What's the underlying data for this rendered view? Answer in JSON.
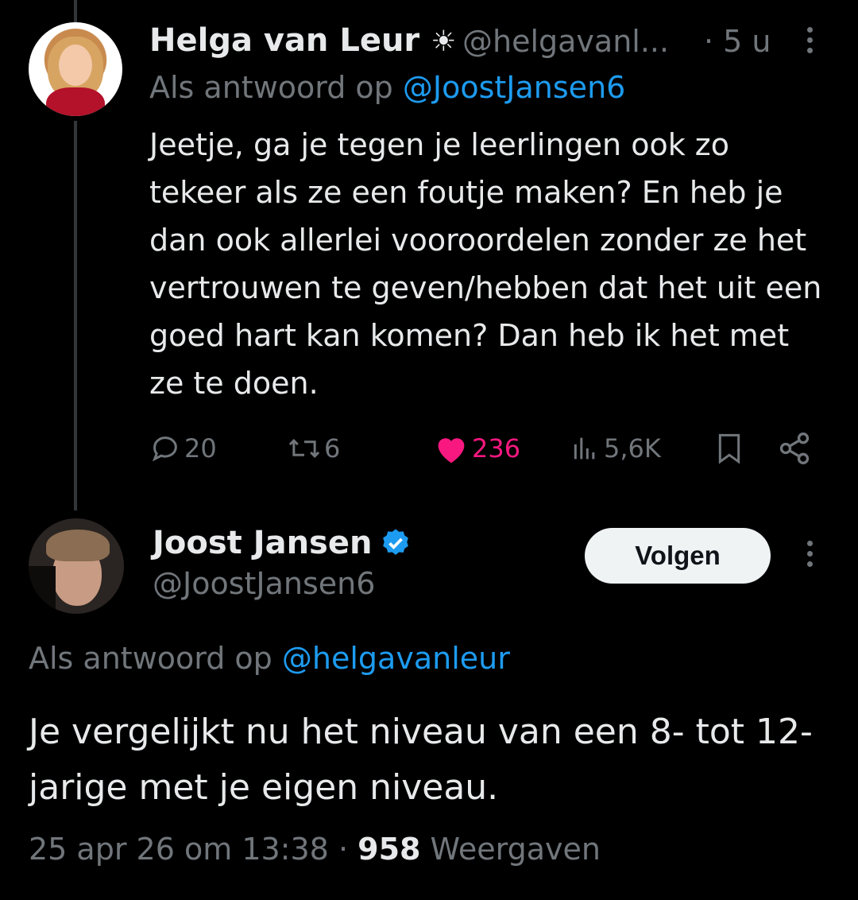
{
  "colors": {
    "background": "#000000",
    "text": "#e7e9ea",
    "muted": "#71767b",
    "link": "#1d9bf0",
    "like": "#f91880"
  },
  "tweet1": {
    "author": "Helga van Leur",
    "emoji": "☀️",
    "handle": "@helgavanl...",
    "time": "· 5 u",
    "reply_prefix": "Als antwoord op",
    "reply_to": "@JoostJansen6",
    "text": "Jeetje, ga je tegen je leerlingen ook zo tekeer als ze een foutje maken? En heb je dan ook allerlei vooroordelen zonder ze het vertrouwen te geven/hebben dat het uit een goed hart kan komen? Dan heb ik het met ze te doen.",
    "replies": "20",
    "reposts": "6",
    "likes": "236",
    "views": "5,6K",
    "icons": [
      "reply-icon",
      "repost-icon",
      "like-icon",
      "views-icon",
      "bookmark-icon",
      "share-icon"
    ]
  },
  "tweet2": {
    "author": "Joost Jansen",
    "verified_icon": "verified-badge-icon",
    "handle": "@JoostJansen6",
    "follow_label": "Volgen",
    "reply_prefix": "Als antwoord op",
    "reply_to": "@helgavanleur",
    "text": "Je vergelijkt nu het niveau van een 8- tot 12-jarige met je eigen niveau.",
    "timestamp": "25 apr 26 om 13:38",
    "separator": "·",
    "views_count": "958",
    "views_label": "Weergaven"
  }
}
